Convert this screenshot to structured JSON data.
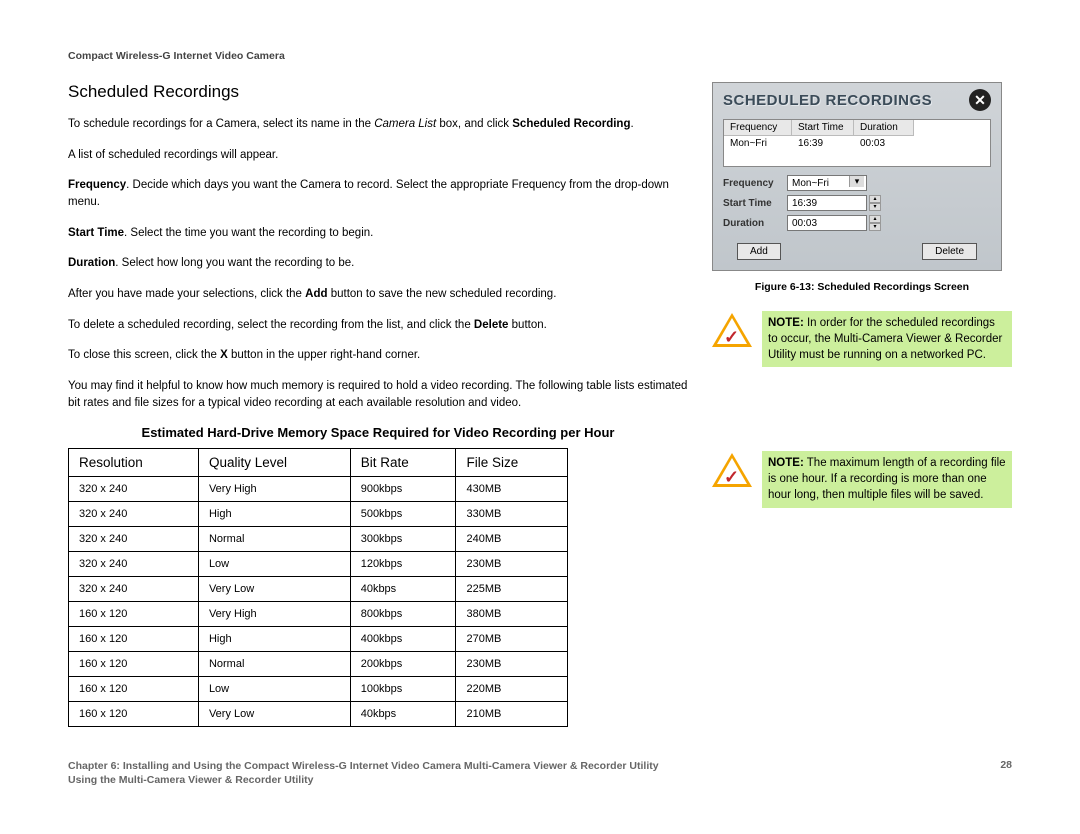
{
  "header": "Compact Wireless-G Internet Video Camera",
  "section_title": "Scheduled Recordings",
  "paragraphs": {
    "p1a": "To schedule recordings for a Camera, select its name in the ",
    "p1b": "Camera List",
    "p1c": " box, and click ",
    "p1d": "Scheduled Recording",
    "p1e": ".",
    "p2": "A list of scheduled recordings will appear.",
    "p3a": "Frequency",
    "p3b": ". Decide which days you want the Camera to record. Select the appropriate Frequency from the drop-down menu.",
    "p4a": "Start Time",
    "p4b": ". Select the time you want the recording to begin.",
    "p5a": "Duration",
    "p5b": ". Select how long you want the recording to be.",
    "p6a": "After you have made your selections, click the ",
    "p6b": "Add",
    "p6c": " button to save the new scheduled recording.",
    "p7a": "To delete a scheduled recording, select the recording from the list, and click the ",
    "p7b": "Delete",
    "p7c": " button.",
    "p8a": "To close this screen, click the ",
    "p8b": "X",
    "p8c": " button in the upper right-hand corner.",
    "p9": "You may find it helpful to know how much memory is required to hold a video recording. The following table lists estimated bit rates and file sizes for a typical video recording at each available resolution and video."
  },
  "table_title": "Estimated Hard-Drive Memory Space Required for Video Recording per Hour",
  "table": {
    "headers": [
      "Resolution",
      "Quality Level",
      "Bit Rate",
      "File Size"
    ],
    "rows": [
      [
        "320 x 240",
        "Very High",
        "900kbps",
        "430MB"
      ],
      [
        "320 x 240",
        "High",
        "500kbps",
        "330MB"
      ],
      [
        "320 x 240",
        "Normal",
        "300kbps",
        "240MB"
      ],
      [
        "320 x 240",
        "Low",
        "120kbps",
        "230MB"
      ],
      [
        "320 x 240",
        "Very Low",
        "40kbps",
        "225MB"
      ],
      [
        "160 x 120",
        "Very High",
        "800kbps",
        "380MB"
      ],
      [
        "160 x 120",
        "High",
        "400kbps",
        "270MB"
      ],
      [
        "160 x 120",
        "Normal",
        "200kbps",
        "230MB"
      ],
      [
        "160 x 120",
        "Low",
        "100kbps",
        "220MB"
      ],
      [
        "160 x 120",
        "Very Low",
        "40kbps",
        "210MB"
      ]
    ]
  },
  "figure": {
    "title": "SCHEDULED RECORDINGS",
    "list_headers": [
      "Frequency",
      "Start Time",
      "Duration"
    ],
    "list_row": [
      "Mon~Fri",
      "16:39",
      "00:03"
    ],
    "form": {
      "labels": [
        "Frequency",
        "Start Time",
        "Duration"
      ],
      "values": [
        "Mon~Fri",
        "16:39",
        "00:03"
      ]
    },
    "buttons": {
      "add": "Add",
      "delete": "Delete"
    },
    "caption": "Figure 6-13: Scheduled Recordings Screen"
  },
  "notes": {
    "n1a": "NOTE:",
    "n1b": " In order for the scheduled recordings to occur, the Multi-Camera Viewer & Recorder Utility must be running on a networked PC.",
    "n2a": "NOTE:",
    "n2b": " The maximum length of a recording file is one hour. If a recording is more than one hour long, then multiple files will be saved."
  },
  "footer": {
    "left1": "Chapter 6: Installing and Using the Compact Wireless-G Internet Video Camera Multi-Camera Viewer & Recorder Utility",
    "left2": "Using the Multi-Camera Viewer & Recorder Utility",
    "page": "28"
  },
  "chart_data": {
    "type": "table",
    "title": "Estimated Hard-Drive Memory Space Required for Video Recording per Hour",
    "columns": [
      "Resolution",
      "Quality Level",
      "Bit Rate",
      "File Size"
    ],
    "rows": [
      {
        "Resolution": "320 x 240",
        "Quality Level": "Very High",
        "Bit Rate": "900kbps",
        "File Size": "430MB"
      },
      {
        "Resolution": "320 x 240",
        "Quality Level": "High",
        "Bit Rate": "500kbps",
        "File Size": "330MB"
      },
      {
        "Resolution": "320 x 240",
        "Quality Level": "Normal",
        "Bit Rate": "300kbps",
        "File Size": "240MB"
      },
      {
        "Resolution": "320 x 240",
        "Quality Level": "Low",
        "Bit Rate": "120kbps",
        "File Size": "230MB"
      },
      {
        "Resolution": "320 x 240",
        "Quality Level": "Very Low",
        "Bit Rate": "40kbps",
        "File Size": "225MB"
      },
      {
        "Resolution": "160 x 120",
        "Quality Level": "Very High",
        "Bit Rate": "800kbps",
        "File Size": "380MB"
      },
      {
        "Resolution": "160 x 120",
        "Quality Level": "High",
        "Bit Rate": "400kbps",
        "File Size": "270MB"
      },
      {
        "Resolution": "160 x 120",
        "Quality Level": "Normal",
        "Bit Rate": "200kbps",
        "File Size": "230MB"
      },
      {
        "Resolution": "160 x 120",
        "Quality Level": "Low",
        "Bit Rate": "100kbps",
        "File Size": "220MB"
      },
      {
        "Resolution": "160 x 120",
        "Quality Level": "Very Low",
        "Bit Rate": "40kbps",
        "File Size": "210MB"
      }
    ]
  }
}
